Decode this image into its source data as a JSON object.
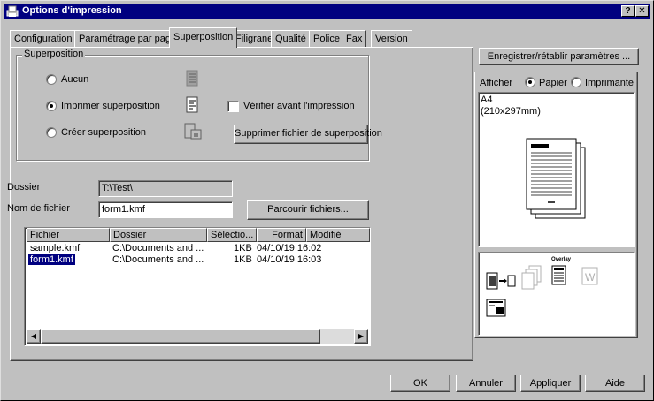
{
  "title": "Options d'impression",
  "tabs": [
    "Configuration",
    "Paramétrage par page",
    "Superposition",
    "Filigrane",
    "Qualité",
    "Police",
    "Fax",
    "Version"
  ],
  "active_tab": "Superposition",
  "overlay_group": {
    "label": "Superposition",
    "none": "Aucun",
    "print": "Imprimer superposition",
    "create": "Créer superposition",
    "selected": "print",
    "verify_label": "Vérifier avant l'impression",
    "delete_button": "Supprimer fichier de superposition"
  },
  "folder": {
    "label": "Dossier",
    "value": "T:\\Test\\"
  },
  "filename": {
    "label": "Nom de fichier",
    "value": "form1.kmf"
  },
  "browse_button": "Parcourir fichiers...",
  "file_list": {
    "columns": [
      "Fichier",
      "Dossier",
      "Sélectio...",
      "Format",
      "Modifié"
    ],
    "rows": [
      {
        "file": "sample.kmf",
        "folder": "C:\\Documents and ...",
        "size": "1KB",
        "date": "04/10/19 16:02"
      },
      {
        "file": "form1.kmf",
        "folder": "C:\\Documents and ...",
        "size": "1KB",
        "date": "04/10/19 16:03"
      }
    ],
    "selected_index": 1
  },
  "right_panel": {
    "save_button": "Enregistrer/rétablir paramètres ...",
    "show_label": "Afficher",
    "paper_option": "Papier",
    "printer_option": "Imprimante",
    "show_selected": "paper",
    "paper_size": "A4",
    "paper_dims": "(210x297mm)",
    "overlay_icon_label": "Overlay"
  },
  "buttons": {
    "ok": "OK",
    "cancel": "Annuler",
    "apply": "Appliquer",
    "help": "Aide"
  },
  "colors": {
    "titlebar": "#000080",
    "face": "#c0c0c0",
    "selection": "#000080"
  }
}
